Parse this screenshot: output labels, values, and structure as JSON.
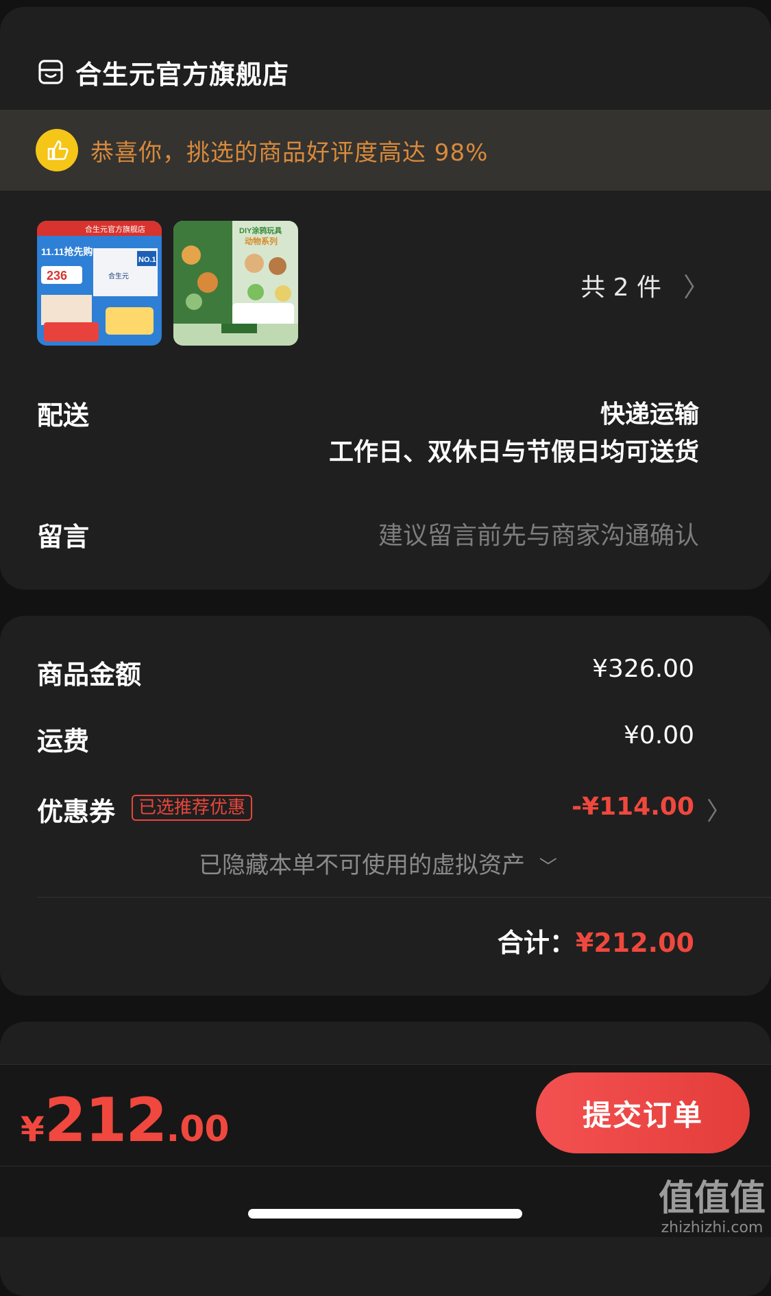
{
  "store": {
    "name": "合生元官方旗舰店",
    "icon": "store-icon"
  },
  "banner": {
    "text": "恭喜你，挑选的商品好评度高达 98%",
    "icon": "thumbs-up-icon"
  },
  "products": {
    "count_label": "共 2 件",
    "items": [
      {
        "name": "product-1",
        "texts": [
          "合生元官方旗舰店",
          "11.11抢先购",
          "236",
          "NO.1",
          "合生元"
        ]
      },
      {
        "name": "product-2",
        "texts": [
          "DIY涂鸦玩具",
          "动物系列"
        ]
      }
    ]
  },
  "delivery": {
    "label": "配送",
    "method": "快递运输",
    "schedule": "工作日、双休日与节假日均可送货"
  },
  "message": {
    "label": "留言",
    "placeholder": "建议留言前先与商家沟通确认"
  },
  "summary": {
    "goods_label": "商品金额",
    "goods_value": "¥326.00",
    "shipping_label": "运费",
    "shipping_value": "¥0.00",
    "coupon_label": "优惠券",
    "coupon_tag": "已选推荐优惠",
    "coupon_value": "-¥114.00",
    "hidden_assets": "已隐藏本单不可使用的虚拟资产",
    "total_label": "合计：",
    "total_value": "¥212.00"
  },
  "footer": {
    "currency": "¥",
    "price_int": "212",
    "price_dec": ".00",
    "submit_label": "提交订单"
  },
  "watermark": {
    "big": "值值值",
    "small": "zhizhizhi.com"
  },
  "colors": {
    "accent": "#f0483e",
    "banner_text": "#d98a3c",
    "badge": "#f5c518"
  }
}
